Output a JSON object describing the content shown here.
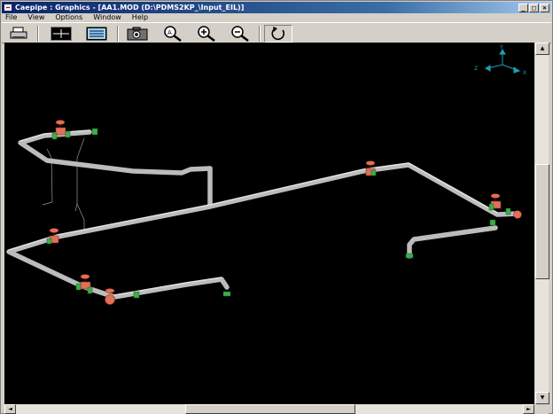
{
  "window": {
    "title": "Caepipe : Graphics - [AA1.MOD (D:\\PDMS2KP_\\Input_EIL)]",
    "controls": {
      "minimize": "_",
      "maximize": "□",
      "close": "×"
    }
  },
  "menubar": {
    "items": [
      "File",
      "View",
      "Options",
      "Window",
      "Help"
    ]
  },
  "toolbar": {
    "buttons": [
      {
        "name": "print-button",
        "icon": "printer-icon"
      },
      {
        "name": "show-nodes-button",
        "icon": "crosshair-frame-icon"
      },
      {
        "name": "show-list-button",
        "icon": "list-frame-icon"
      },
      {
        "name": "camera-button",
        "icon": "camera-icon"
      },
      {
        "name": "zoom-window-button",
        "icon": "magnifier-window-icon"
      },
      {
        "name": "zoom-in-button",
        "icon": "zoom-in-icon"
      },
      {
        "name": "zoom-out-button",
        "icon": "zoom-out-icon"
      },
      {
        "name": "rotate-button",
        "icon": "rotate-icon"
      }
    ]
  },
  "axis_triad": {
    "labels": {
      "y": "Y",
      "z": "Z",
      "x": "X"
    },
    "color": "#1aa0b0"
  },
  "model": {
    "background": "#000000",
    "pipe_color": "#bcbcbc",
    "valve_color": "#e0705a",
    "flange_color": "#3ab04a"
  },
  "scrollbars": {
    "up": "▲",
    "down": "▼",
    "left": "◄",
    "right": "►"
  }
}
